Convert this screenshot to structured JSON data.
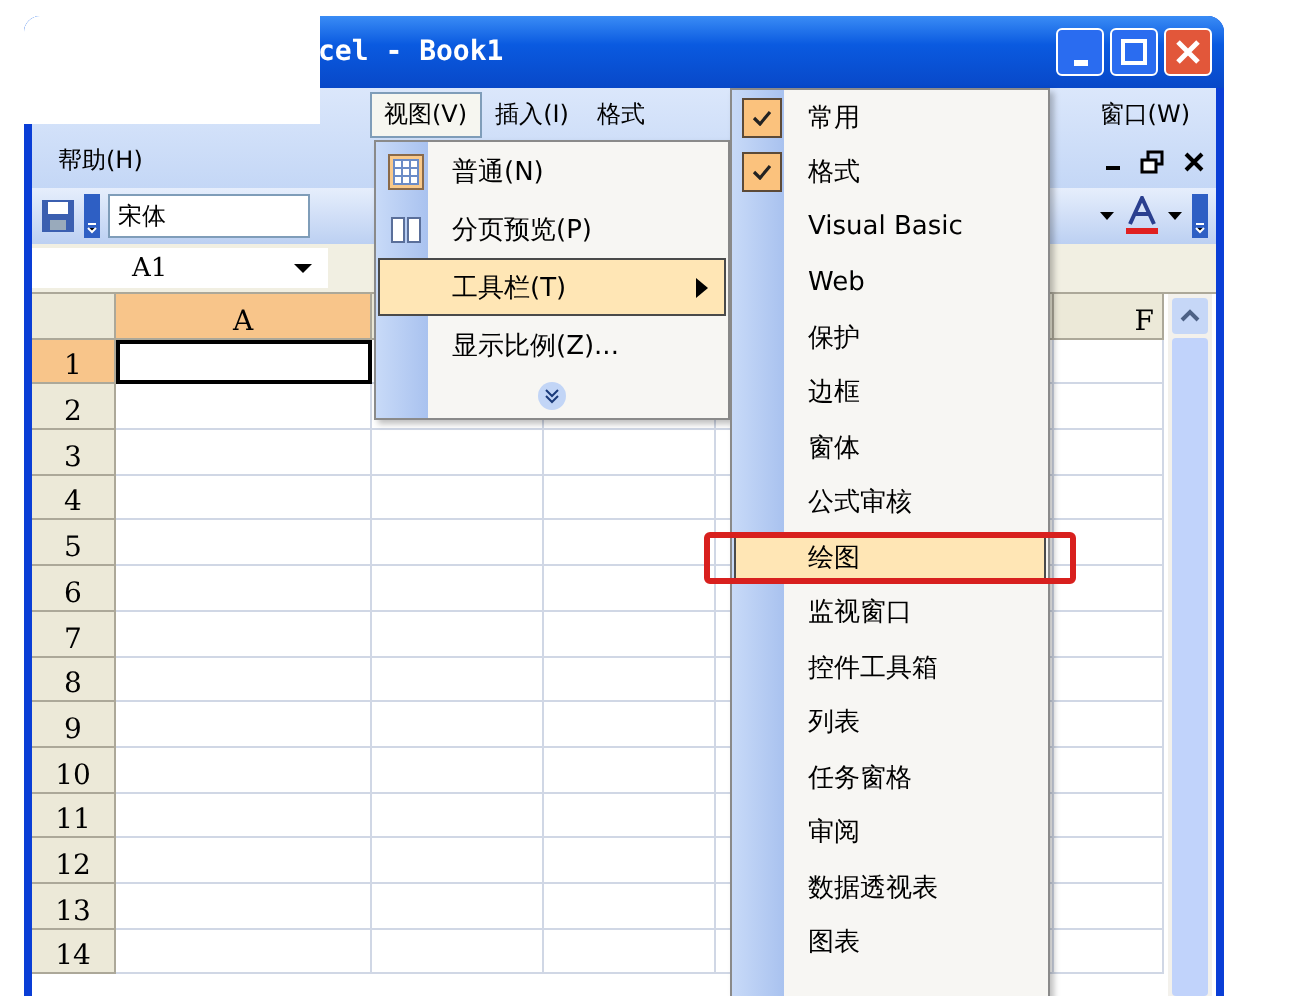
{
  "window": {
    "title": "cel - Book1"
  },
  "menu_bar": {
    "items": [
      {
        "label": "视图(V)",
        "selected": true
      },
      {
        "label": "插入(I)",
        "selected": false
      },
      {
        "label": "格式",
        "selected": false
      }
    ],
    "right_items": [
      {
        "label": "窗口(W)",
        "selected": false
      }
    ],
    "second_row": [
      {
        "label": "帮助(H)",
        "selected": false
      }
    ]
  },
  "toolbar": {
    "font_name": "宋体"
  },
  "formula_bar": {
    "name_box": "A1"
  },
  "columns": [
    {
      "label": "A",
      "selected": true
    },
    {
      "label": "F",
      "selected": false
    }
  ],
  "rows": [
    {
      "label": "1",
      "selected": true
    },
    {
      "label": "2",
      "selected": false
    },
    {
      "label": "3",
      "selected": false
    },
    {
      "label": "4",
      "selected": false
    },
    {
      "label": "5",
      "selected": false
    },
    {
      "label": "6",
      "selected": false
    },
    {
      "label": "7",
      "selected": false
    },
    {
      "label": "8",
      "selected": false
    },
    {
      "label": "9",
      "selected": false
    },
    {
      "label": "10",
      "selected": false
    },
    {
      "label": "11",
      "selected": false
    },
    {
      "label": "12",
      "selected": false
    },
    {
      "label": "13",
      "selected": false
    },
    {
      "label": "14",
      "selected": false
    }
  ],
  "view_menu": {
    "items": [
      {
        "label": "普通(N)",
        "kind": "grid",
        "selected": false
      },
      {
        "label": "分页预览(P)",
        "kind": "pages",
        "selected": false
      },
      {
        "label": "工具栏(T)",
        "kind": "submenu",
        "selected": true
      },
      {
        "label": "显示比例(Z)...",
        "kind": "plain",
        "selected": false
      },
      {
        "kind": "expand"
      }
    ]
  },
  "toolbars_menu": {
    "items": [
      {
        "label": "常用",
        "checked": true,
        "selected": false,
        "circled": false
      },
      {
        "label": "格式",
        "checked": true,
        "selected": false,
        "circled": false
      },
      {
        "label": "Visual Basic",
        "checked": false,
        "selected": false,
        "circled": false
      },
      {
        "label": "Web",
        "checked": false,
        "selected": false,
        "circled": false
      },
      {
        "label": "保护",
        "checked": false,
        "selected": false,
        "circled": false
      },
      {
        "label": "边框",
        "checked": false,
        "selected": false,
        "circled": false
      },
      {
        "label": "窗体",
        "checked": false,
        "selected": false,
        "circled": false
      },
      {
        "label": "公式审核",
        "checked": false,
        "selected": false,
        "circled": false
      },
      {
        "label": "绘图",
        "checked": false,
        "selected": true,
        "circled": true
      },
      {
        "label": "监视窗口",
        "checked": false,
        "selected": false,
        "circled": false
      },
      {
        "label": "控件工具箱",
        "checked": false,
        "selected": false,
        "circled": false
      },
      {
        "label": "列表",
        "checked": false,
        "selected": false,
        "circled": false
      },
      {
        "label": "任务窗格",
        "checked": false,
        "selected": false,
        "circled": false
      },
      {
        "label": "审阅",
        "checked": false,
        "selected": false,
        "circled": false
      },
      {
        "label": "数据透视表",
        "checked": false,
        "selected": false,
        "circled": false
      },
      {
        "label": "图表",
        "checked": false,
        "selected": false,
        "circled": false
      }
    ]
  }
}
